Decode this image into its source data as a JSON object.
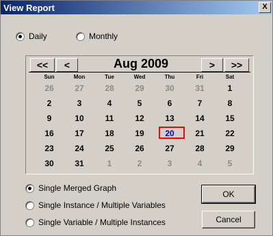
{
  "window": {
    "title": "View Report",
    "close_label": "X"
  },
  "period": {
    "daily": "Daily",
    "monthly": "Monthly",
    "selected": "daily"
  },
  "calendar": {
    "month_label": "Aug 2009",
    "nav": {
      "prev_year": "<<",
      "prev_month": "<",
      "next_month": ">",
      "next_year": ">>"
    },
    "weekdays": [
      "Sun",
      "Mon",
      "Tue",
      "Wed",
      "Thu",
      "Fri",
      "Sat"
    ],
    "weeks": [
      [
        "26",
        "27",
        "28",
        "29",
        "30",
        "31",
        "1"
      ],
      [
        "2",
        "3",
        "4",
        "5",
        "6",
        "7",
        "8"
      ],
      [
        "9",
        "10",
        "11",
        "12",
        "13",
        "14",
        "15"
      ],
      [
        "16",
        "17",
        "18",
        "19",
        "20",
        "21",
        "22"
      ],
      [
        "23",
        "24",
        "25",
        "26",
        "27",
        "28",
        "29"
      ],
      [
        "30",
        "31",
        "1",
        "2",
        "3",
        "4",
        "5"
      ]
    ],
    "selected_day": "20"
  },
  "graph_options": {
    "single_merged": "Single Merged Graph",
    "instance_multi_vars": "Single Instance / Multiple Variables",
    "variable_multi_instances": "Single Variable / Multiple Instances",
    "selected": "single_merged"
  },
  "buttons": {
    "ok": "OK",
    "cancel": "Cancel"
  }
}
